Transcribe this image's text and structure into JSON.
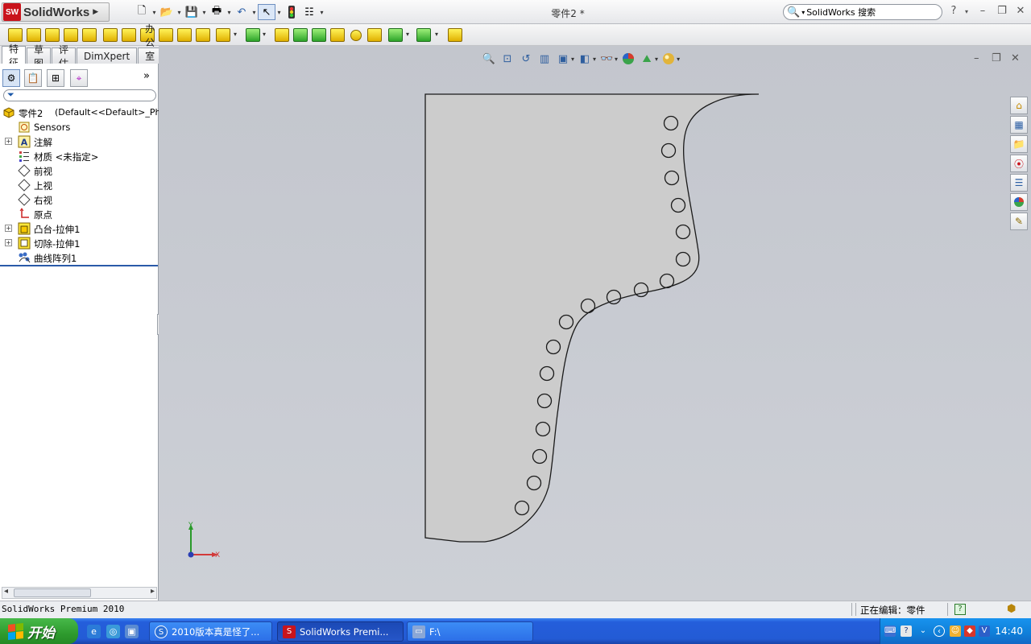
{
  "app": {
    "logo_brand": "SolidWorks",
    "window_title": "零件2 *",
    "search_placeholder": "SolidWorks 搜索"
  },
  "title_controls": {
    "help": "?",
    "minimize": "–",
    "restore": "❐",
    "close": "✕"
  },
  "tabs": [
    {
      "label": "特征",
      "active": true
    },
    {
      "label": "草图",
      "active": false
    },
    {
      "label": "评估",
      "active": false
    },
    {
      "label": "DimXpert",
      "active": false
    },
    {
      "label": "办公室产品",
      "active": false
    }
  ],
  "panel": {
    "expand_label": "»",
    "filter_icon": "filter-icon"
  },
  "tree": {
    "root": {
      "label": "零件2",
      "config": "(Default<<Default>_Ph"
    },
    "items": [
      {
        "label": "Sensors",
        "icon": "sensor-icon",
        "expandable": false
      },
      {
        "label": "注解",
        "icon": "annotation-icon",
        "expandable": true
      },
      {
        "label": "材质 <未指定>",
        "icon": "material-icon",
        "expandable": false
      },
      {
        "label": "前视",
        "icon": "plane-icon",
        "expandable": false
      },
      {
        "label": "上视",
        "icon": "plane-icon",
        "expandable": false
      },
      {
        "label": "右视",
        "icon": "plane-icon",
        "expandable": false
      },
      {
        "label": "原点",
        "icon": "origin-icon",
        "expandable": false
      },
      {
        "label": "凸台-拉伸1",
        "icon": "boss-extrude-icon",
        "expandable": true
      },
      {
        "label": "切除-拉伸1",
        "icon": "cut-extrude-icon",
        "expandable": true
      },
      {
        "label": "曲线阵列1",
        "icon": "curve-pattern-icon",
        "expandable": false
      }
    ]
  },
  "viewport": {
    "triad_x": "X",
    "triad_y": "Y",
    "view_min": "–",
    "view_restore": "❐",
    "view_close": "✕"
  },
  "status": {
    "product": "SolidWorks Premium 2010",
    "editing": "正在编辑：零件",
    "help": "?"
  },
  "taskbar": {
    "start": "开始",
    "items": [
      {
        "label": "2010版本真是怪了...",
        "icon": "browser-icon"
      },
      {
        "label": "SolidWorks Premi...",
        "icon": "solidworks-icon",
        "active": true
      },
      {
        "label": "F:\\",
        "icon": "folder-icon"
      }
    ],
    "clock": "14:40"
  },
  "colors": {
    "brand_red": "#c9141c",
    "viewport_bg": "#c6c9d0",
    "part_fill": "#cccccc",
    "taskbar_blue": "#245edb",
    "start_green": "#3aa53a"
  }
}
